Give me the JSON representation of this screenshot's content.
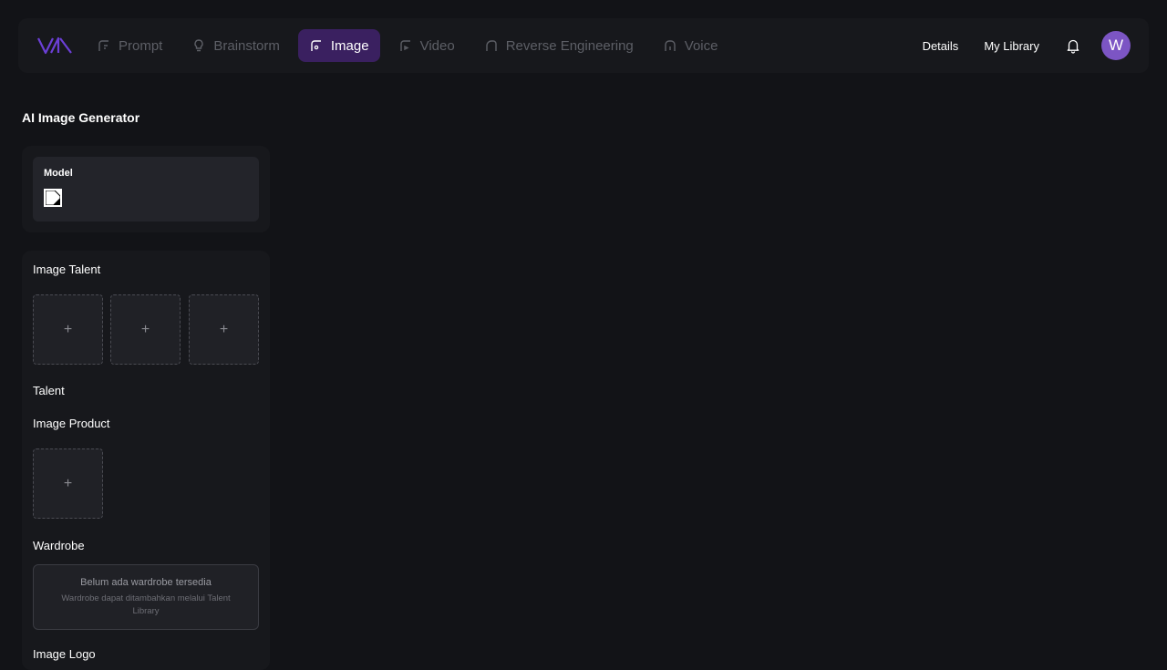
{
  "nav": {
    "items": [
      {
        "label": "Prompt",
        "icon": "prompt-icon"
      },
      {
        "label": "Brainstorm",
        "icon": "bulb-icon"
      },
      {
        "label": "Image",
        "icon": "image-icon",
        "active": true
      },
      {
        "label": "Video",
        "icon": "video-icon"
      },
      {
        "label": "Reverse Engineering",
        "icon": "reverse-icon"
      },
      {
        "label": "Voice",
        "icon": "voice-icon"
      }
    ],
    "details_label": "Details",
    "library_label": "My Library",
    "avatar_initial": "W"
  },
  "colors": {
    "accent": "#3a2060",
    "avatar": "#7c55c4",
    "background": "#121317"
  },
  "page_title": "AI Image Generator",
  "model": {
    "label": "Model"
  },
  "image_talent": {
    "label": "Image Talent",
    "slots": [
      "+",
      "+",
      "+"
    ]
  },
  "talent": {
    "label": "Talent"
  },
  "image_product": {
    "label": "Image Product",
    "slots": [
      "+"
    ]
  },
  "wardrobe": {
    "label": "Wardrobe",
    "empty_title": "Belum ada wardrobe tersedia",
    "empty_hint": "Wardrobe dapat ditambahkan melalui Talent Library"
  },
  "image_logo": {
    "label": "Image Logo"
  }
}
